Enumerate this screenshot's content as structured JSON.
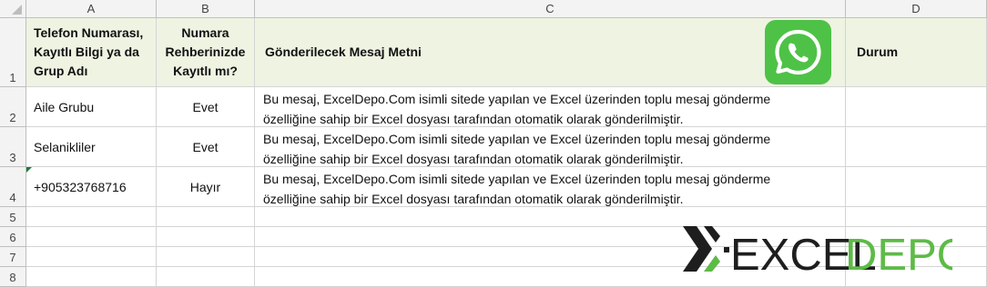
{
  "columns": [
    "A",
    "B",
    "C",
    "D"
  ],
  "rows": [
    "1",
    "2",
    "3",
    "4",
    "5",
    "6",
    "7",
    "8"
  ],
  "header": {
    "a": [
      "Telefon Numarası,",
      "Kayıtlı Bilgi ya da",
      "Grup Adı"
    ],
    "b": [
      "Numara",
      "Rehberinizde",
      "Kayıtlı mı?"
    ],
    "c": "Gönderilecek Mesaj Metni",
    "d": "Durum"
  },
  "data_rows": [
    {
      "a": "Aile Grubu",
      "b": "Evet",
      "c": [
        "Bu mesaj, ExcelDepo.Com isimli sitede yapılan ve Excel üzerinden toplu mesaj gönderme",
        "özelliğine sahip bir Excel dosyası tarafından otomatik olarak gönderilmiştir."
      ],
      "d": ""
    },
    {
      "a": "Selanikliler",
      "b": "Evet",
      "c": [
        "Bu mesaj, ExcelDepo.Com isimli sitede yapılan ve Excel üzerinden toplu mesaj gönderme",
        "özelliğine sahip bir Excel dosyası tarafından otomatik olarak gönderilmiştir."
      ],
      "d": ""
    },
    {
      "a": "+905323768716",
      "b": "Hayır",
      "c": [
        "Bu mesaj, ExcelDepo.Com isimli sitede yapılan ve Excel üzerinden toplu mesaj gönderme",
        "özelliğine sahip bir Excel dosyası tarafından otomatik olarak gönderilmiştir."
      ],
      "d": ""
    }
  ],
  "logo": {
    "part1": "EXCEL",
    "part2": "DEPO"
  },
  "colors": {
    "header_fill": "#eef3e2",
    "whatsapp_green": "#4ec246",
    "logo_green": "#5dbb46",
    "logo_dark": "#1e1e1e",
    "error_indicator": "#1f7a3d"
  },
  "icons": {
    "whatsapp": "whatsapp-icon",
    "logo_mark": "x-mark-icon"
  }
}
